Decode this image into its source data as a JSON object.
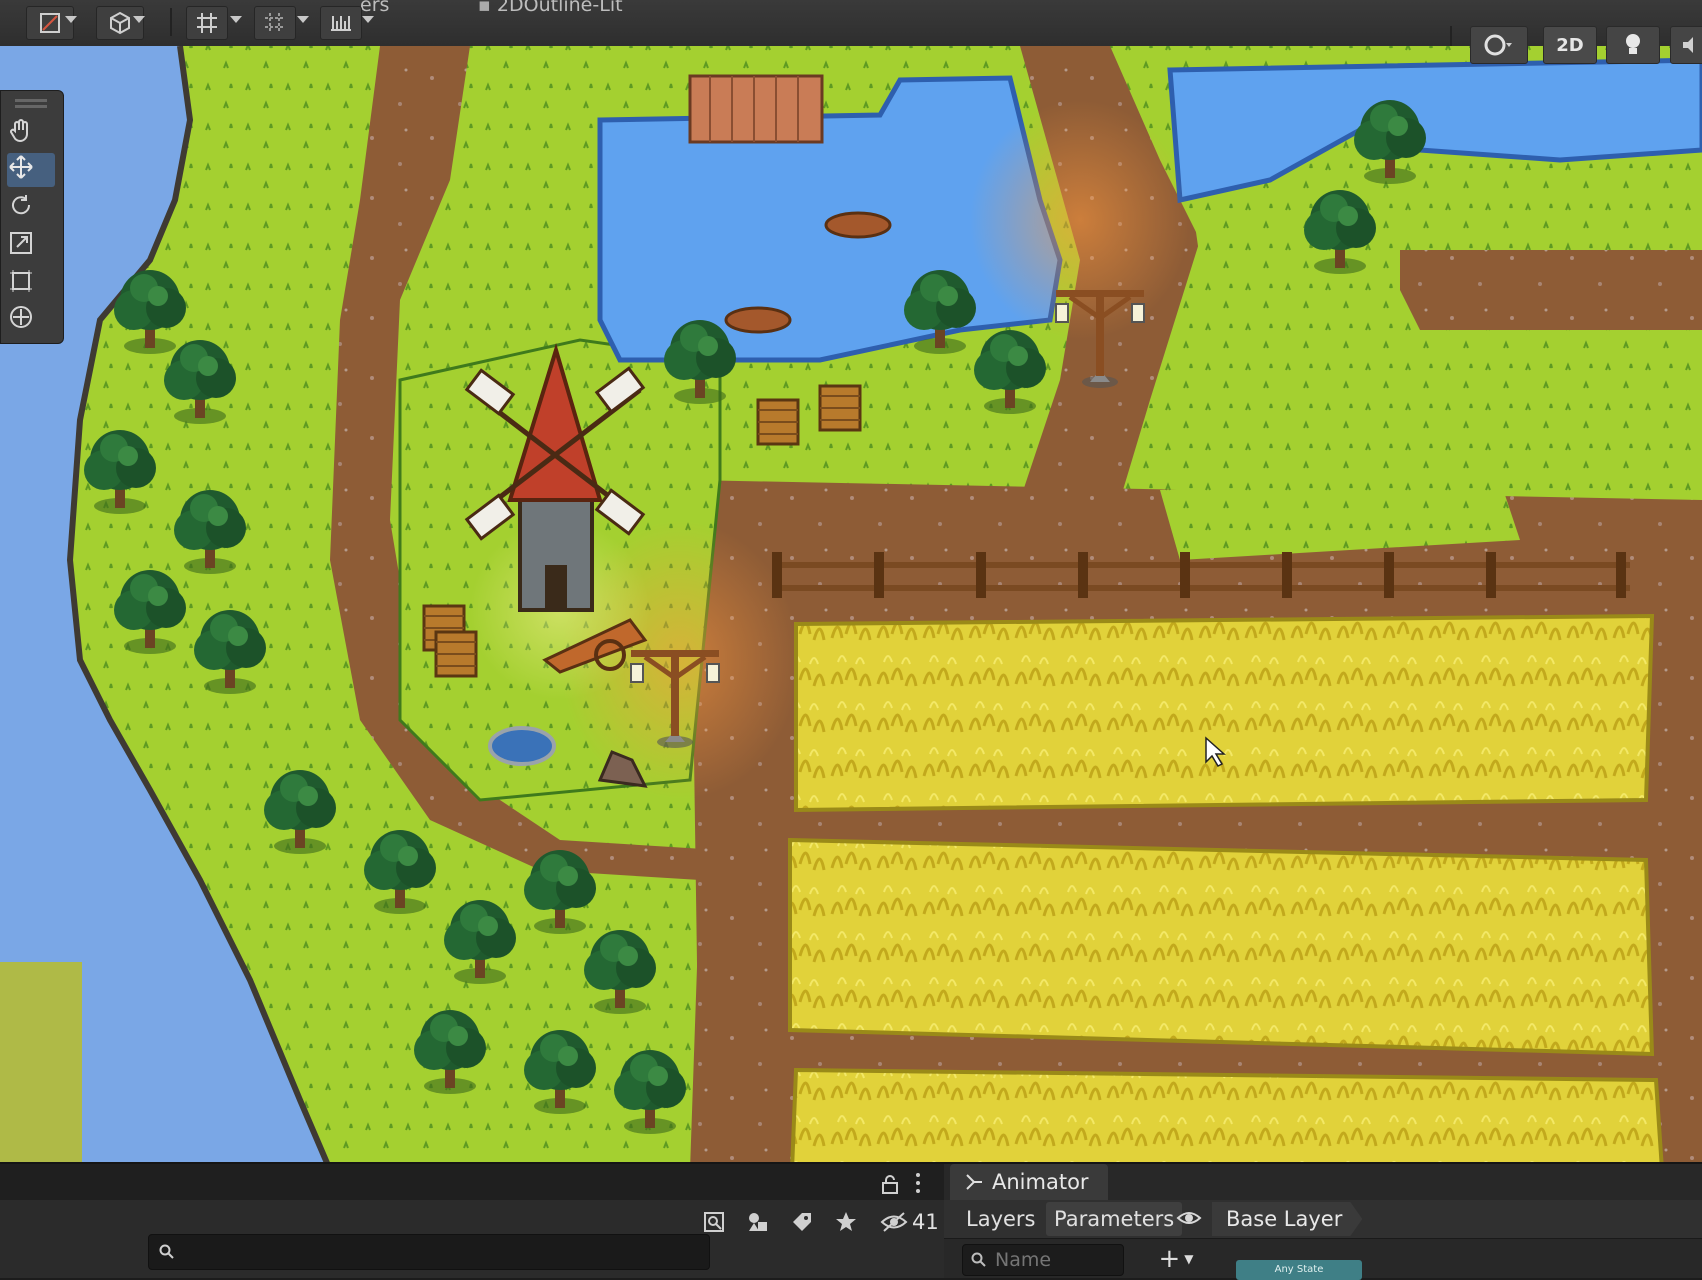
{
  "window": {
    "tab_partial": "ers",
    "scene_tab": "2DOutline-Lit"
  },
  "scene_toolbar": {
    "mode_2d_label": "2D"
  },
  "tools": [
    {
      "name": "hand-tool",
      "icon": "hand-icon",
      "active": false
    },
    {
      "name": "move-tool",
      "icon": "move-icon",
      "active": true
    },
    {
      "name": "rotate-tool",
      "icon": "rotate-icon",
      "active": false
    },
    {
      "name": "scale-tool",
      "icon": "scale-icon",
      "active": false
    },
    {
      "name": "rect-tool",
      "icon": "rect-icon",
      "active": false
    },
    {
      "name": "transform-tool",
      "icon": "transform-icon",
      "active": false
    }
  ],
  "project": {
    "search_placeholder": "",
    "hidden_count": "41"
  },
  "animator": {
    "tab_label": "Animator",
    "layers_label": "Layers",
    "parameters_label": "Parameters",
    "breadcrumb": "Base Layer",
    "name_placeholder": "Name",
    "add_label": "+",
    "any_state_label": "Any State"
  },
  "colors": {
    "water": "#6f9fe0",
    "grass": "#9ccc2e",
    "dirt": "#8c5a36",
    "wheat": "#dccc2a",
    "tree_dark": "#1f5a2e",
    "accent_blue": "#46607f"
  }
}
